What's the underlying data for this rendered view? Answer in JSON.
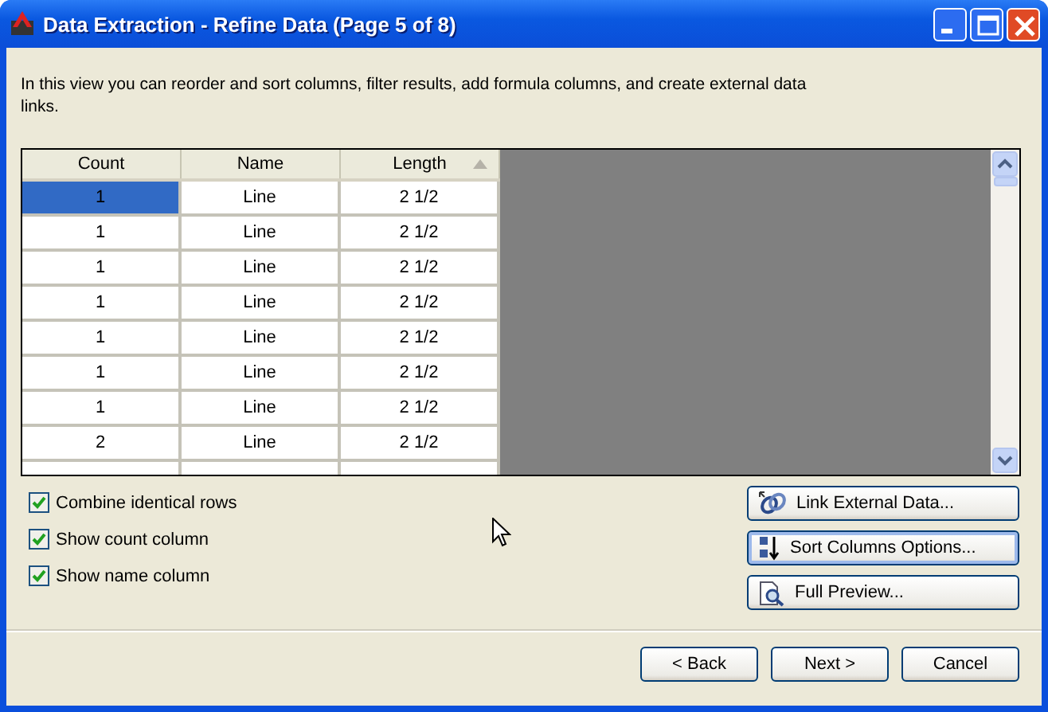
{
  "window": {
    "title": "Data Extraction - Refine Data (Page 5 of 8)"
  },
  "description": "In this view you can reorder and sort columns, filter results, add formula columns, and create external data links.",
  "table": {
    "columns": [
      {
        "label": "Count",
        "sorted": false
      },
      {
        "label": "Name",
        "sorted": false
      },
      {
        "label": "Length",
        "sorted": true
      }
    ],
    "rows": [
      {
        "cells": [
          "1",
          "Line",
          "2 1/2"
        ],
        "selected": true
      },
      {
        "cells": [
          "1",
          "Line",
          "2 1/2"
        ],
        "selected": false
      },
      {
        "cells": [
          "1",
          "Line",
          "2 1/2"
        ],
        "selected": false
      },
      {
        "cells": [
          "1",
          "Line",
          "2 1/2"
        ],
        "selected": false
      },
      {
        "cells": [
          "1",
          "Line",
          "2 1/2"
        ],
        "selected": false
      },
      {
        "cells": [
          "1",
          "Line",
          "2 1/2"
        ],
        "selected": false
      },
      {
        "cells": [
          "1",
          "Line",
          "2 1/2"
        ],
        "selected": false
      },
      {
        "cells": [
          "2",
          "Line",
          "2 1/2"
        ],
        "selected": false
      }
    ]
  },
  "options": [
    {
      "label": "Combine identical rows",
      "checked": true
    },
    {
      "label": "Show count column",
      "checked": true
    },
    {
      "label": "Show name column",
      "checked": true
    }
  ],
  "side_buttons": [
    {
      "label": "Link External Data...",
      "kind": "link"
    },
    {
      "label": "Sort Columns Options...",
      "kind": "sort"
    },
    {
      "label": "Full Preview...",
      "kind": "preview"
    }
  ],
  "buttons": [
    "< Back",
    "Next >",
    "Cancel"
  ]
}
